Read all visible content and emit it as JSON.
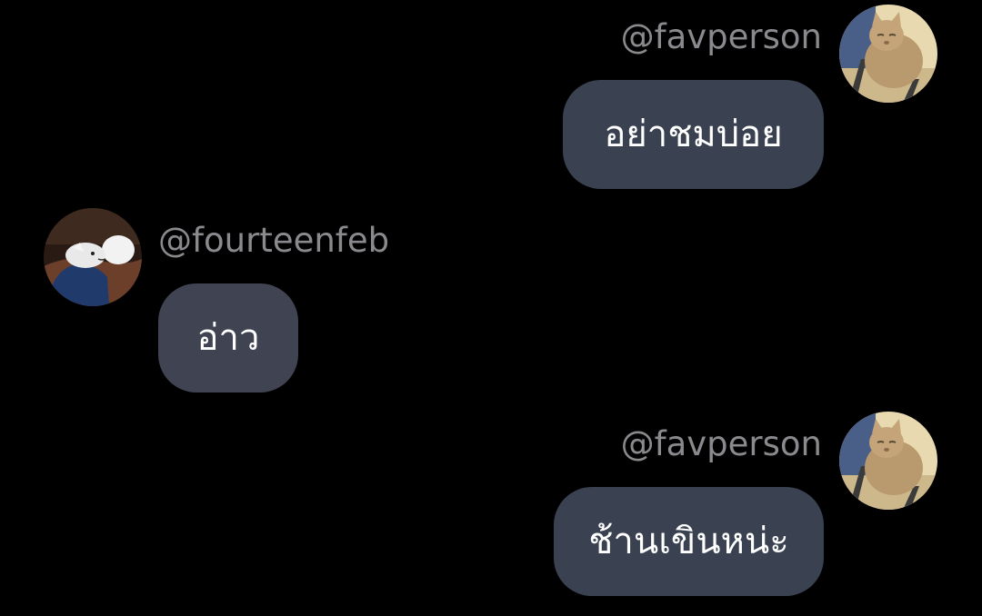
{
  "messages": [
    {
      "side": "right",
      "username": "@favperson",
      "text": "อย่าชมบ่อย",
      "avatar_icon": "cat-avatar-icon"
    },
    {
      "side": "left",
      "username": "@fourteenfeb",
      "text": "อ่าว",
      "avatar_icon": "sleeping-character-avatar-icon"
    },
    {
      "side": "right",
      "username": "@favperson",
      "text": "ช้านเขินหน่ะ",
      "avatar_icon": "cat-avatar-icon"
    }
  ],
  "colors": {
    "background": "#000000",
    "username": "#8a8a8e",
    "bubble_outgoing": "#3a4252",
    "bubble_incoming": "#3f4352",
    "bubble_text": "#ffffff"
  }
}
